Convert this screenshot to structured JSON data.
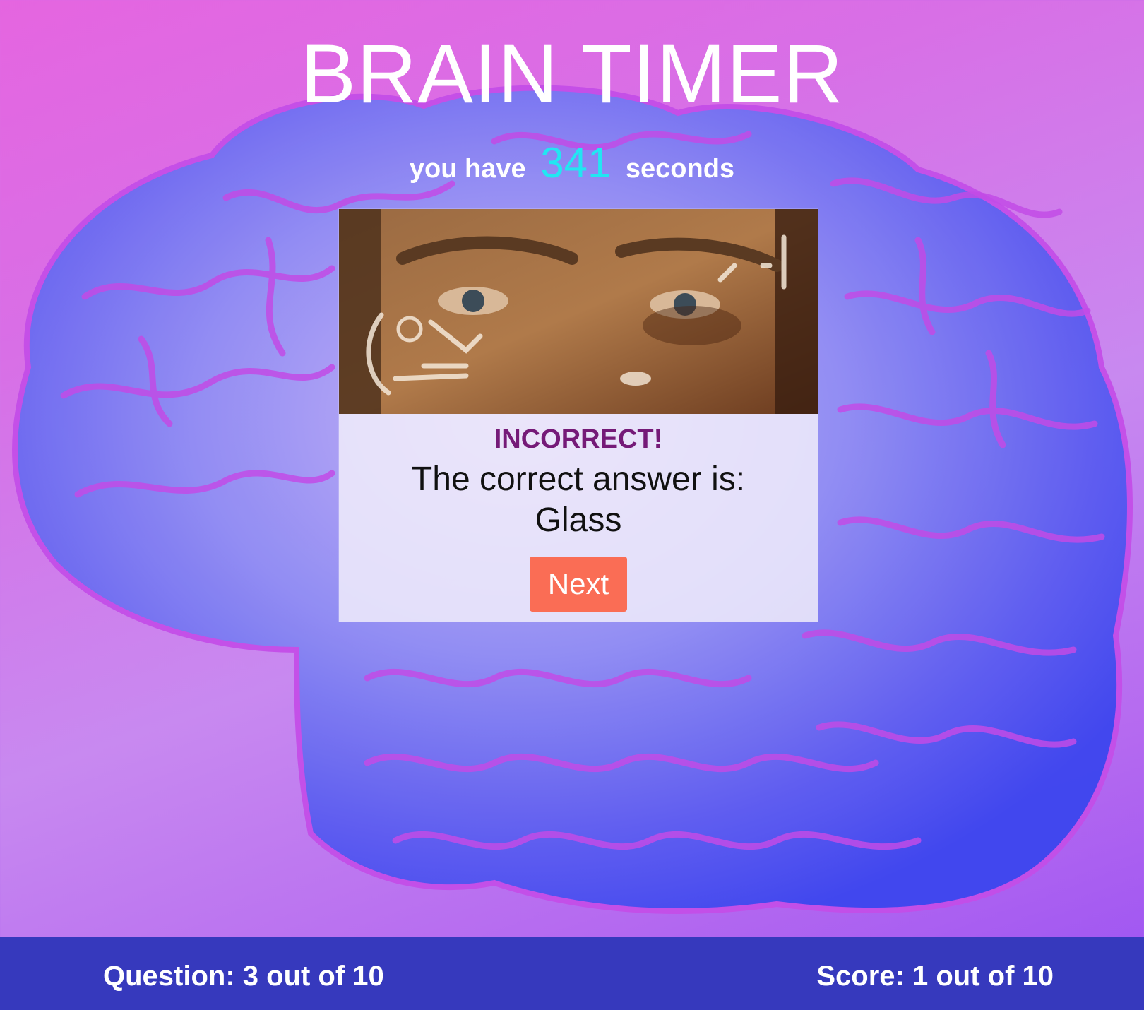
{
  "header": {
    "title": "BRAIN TIMER",
    "timer_prefix": "you have",
    "timer_seconds": "341",
    "timer_suffix": "seconds"
  },
  "card": {
    "result": "INCORRECT!",
    "answer_label": "The correct answer is:",
    "answer_value": "Glass",
    "next_label": "Next"
  },
  "footer": {
    "question_status": "Question: 3 out of 10",
    "score_status": "Score: 1 out of 10"
  },
  "colors": {
    "background_pink": "#e565e0",
    "background_violet": "#9b52f2",
    "timer_accent": "#22e6f2",
    "result_text": "#751a78",
    "next_button": "#fa6d55",
    "footer_bar": "#3639bd"
  },
  "icons": {
    "background": "brain-illustration",
    "card_image": "face-with-math-equations-gif"
  }
}
